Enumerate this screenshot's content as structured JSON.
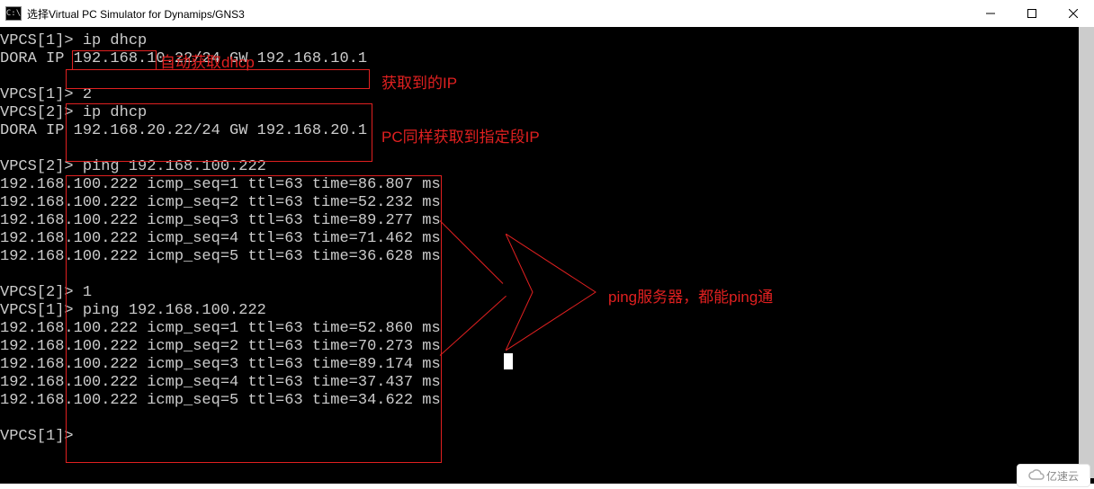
{
  "window": {
    "title": "选择Virtual PC Simulator for Dynamips/GNS3"
  },
  "annotations": {
    "auto_dhcp": "自动获取dhcp",
    "got_ip": "获取到的IP",
    "pc_same_seg": "PC同样获取到指定段IP",
    "ping_ok": "ping服务器，都能ping通"
  },
  "watermark": {
    "text": "亿速云"
  },
  "term_lines": [
    "VPCS[1]> ip dhcp",
    "DORA IP 192.168.10.22/24 GW 192.168.10.1",
    "",
    "VPCS[1]> 2",
    "VPCS[2]> ip dhcp",
    "DORA IP 192.168.20.22/24 GW 192.168.20.1",
    "",
    "VPCS[2]> ping 192.168.100.222",
    "192.168.100.222 icmp_seq=1 ttl=63 time=86.807 ms",
    "192.168.100.222 icmp_seq=2 ttl=63 time=52.232 ms",
    "192.168.100.222 icmp_seq=3 ttl=63 time=89.277 ms",
    "192.168.100.222 icmp_seq=4 ttl=63 time=71.462 ms",
    "192.168.100.222 icmp_seq=5 ttl=63 time=36.628 ms",
    "",
    "VPCS[2]> 1",
    "VPCS[1]> ping 192.168.100.222",
    "192.168.100.222 icmp_seq=1 ttl=63 time=52.860 ms",
    "192.168.100.222 icmp_seq=2 ttl=63 time=70.273 ms",
    "192.168.100.222 icmp_seq=3 ttl=63 time=89.174 ms",
    "192.168.100.222 icmp_seq=4 ttl=63 time=37.437 ms",
    "192.168.100.222 icmp_seq=5 ttl=63 time=34.622 ms",
    "",
    "VPCS[1]>"
  ]
}
